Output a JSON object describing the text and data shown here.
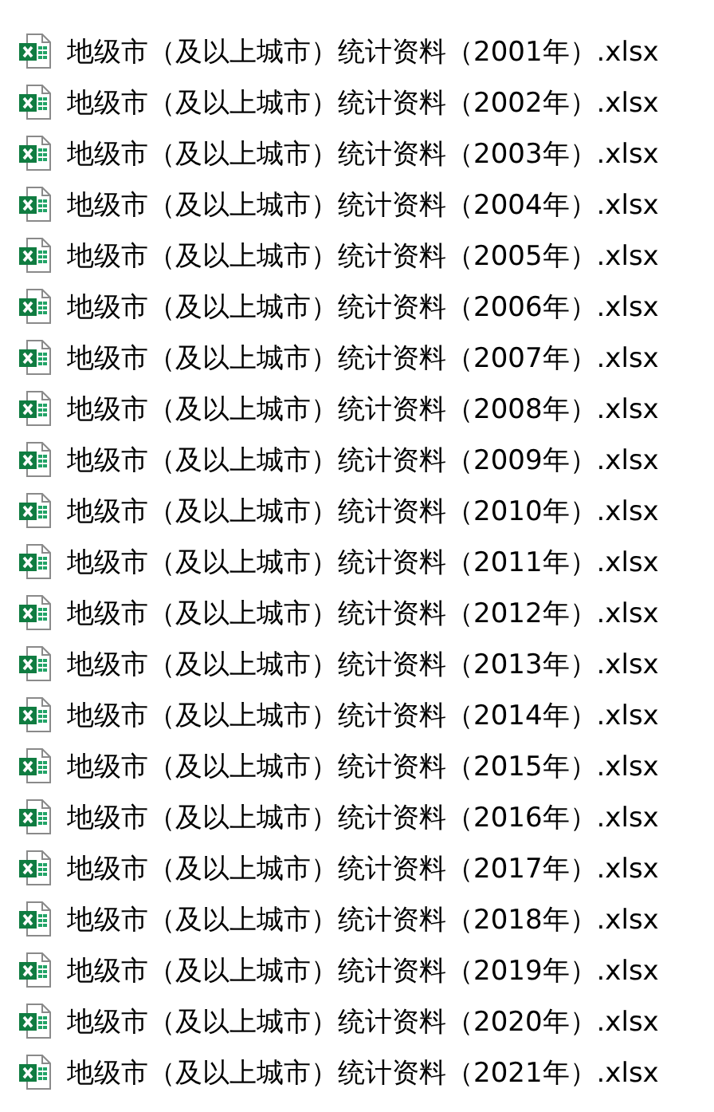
{
  "files": [
    {
      "name": "地级市（及以上城市）统计资料（2001年）.xlsx"
    },
    {
      "name": "地级市（及以上城市）统计资料（2002年）.xlsx"
    },
    {
      "name": "地级市（及以上城市）统计资料（2003年）.xlsx"
    },
    {
      "name": "地级市（及以上城市）统计资料（2004年）.xlsx"
    },
    {
      "name": "地级市（及以上城市）统计资料（2005年）.xlsx"
    },
    {
      "name": "地级市（及以上城市）统计资料（2006年）.xlsx"
    },
    {
      "name": "地级市（及以上城市）统计资料（2007年）.xlsx"
    },
    {
      "name": "地级市（及以上城市）统计资料（2008年）.xlsx"
    },
    {
      "name": "地级市（及以上城市）统计资料（2009年）.xlsx"
    },
    {
      "name": "地级市（及以上城市）统计资料（2010年）.xlsx"
    },
    {
      "name": "地级市（及以上城市）统计资料（2011年）.xlsx"
    },
    {
      "name": "地级市（及以上城市）统计资料（2012年）.xlsx"
    },
    {
      "name": "地级市（及以上城市）统计资料（2013年）.xlsx"
    },
    {
      "name": "地级市（及以上城市）统计资料（2014年）.xlsx"
    },
    {
      "name": "地级市（及以上城市）统计资料（2015年）.xlsx"
    },
    {
      "name": "地级市（及以上城市）统计资料（2016年）.xlsx"
    },
    {
      "name": "地级市（及以上城市）统计资料（2017年）.xlsx"
    },
    {
      "name": "地级市（及以上城市）统计资料（2018年）.xlsx"
    },
    {
      "name": "地级市（及以上城市）统计资料（2019年）.xlsx"
    },
    {
      "name": "地级市（及以上城市）统计资料（2020年）.xlsx"
    },
    {
      "name": "地级市（及以上城市）统计资料（2021年）.xlsx"
    }
  ]
}
